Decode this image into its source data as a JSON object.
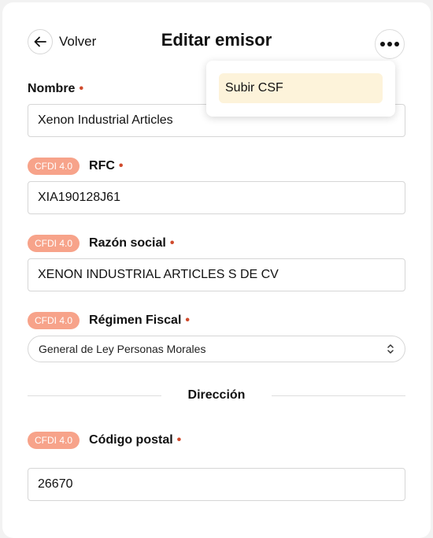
{
  "header": {
    "back_label": "Volver",
    "title": "Editar emisor",
    "more_icon": "more-horizontal-icon",
    "back_icon": "arrow-left-icon"
  },
  "menu": {
    "items": [
      {
        "label": "Subir CSF"
      }
    ]
  },
  "badge_text": "CFDI 4.0",
  "fields": {
    "nombre": {
      "label": "Nombre",
      "required": "•",
      "value": "Xenon Industrial Articles"
    },
    "rfc": {
      "label": "RFC",
      "required": "•",
      "value": "XIA190128J61"
    },
    "razon_social": {
      "label": "Razón social",
      "required": "•",
      "value": "XENON INDUSTRIAL ARTICLES S DE CV"
    },
    "regimen_fiscal": {
      "label": "Régimen Fiscal",
      "required": "•",
      "value": "General de Ley Personas Morales"
    },
    "codigo_postal": {
      "label": "Código postal",
      "required": "•",
      "value": "26670"
    }
  },
  "sections": {
    "direccion": "Dirección"
  },
  "colors": {
    "badge": "#f7a38a",
    "required_marker": "#d04a2c",
    "menu_highlight": "#fdf3da"
  }
}
